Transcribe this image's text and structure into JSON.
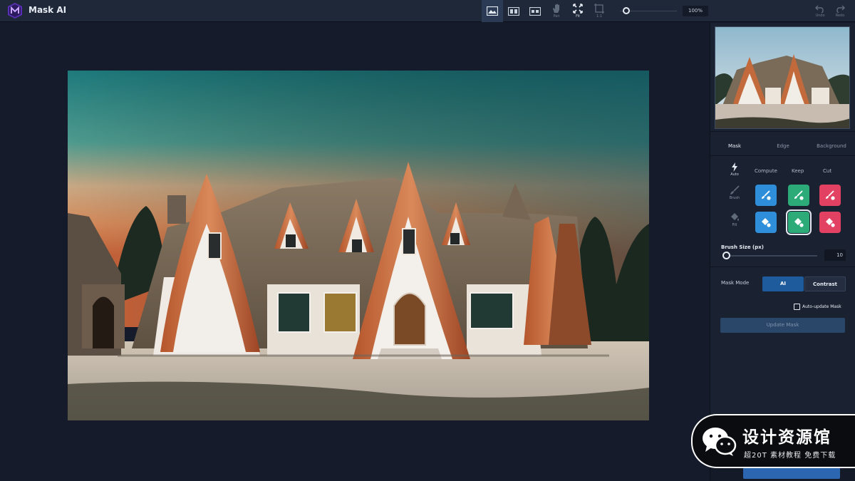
{
  "app": {
    "title": "Mask AI",
    "logo_icon": "mask-ai-logo-icon",
    "accent_color": "#7b3fe4"
  },
  "toolbar": {
    "tools": [
      {
        "name": "single-view-icon",
        "label": "",
        "active": true
      },
      {
        "name": "split-view-icon",
        "label": "",
        "active": false
      },
      {
        "name": "side-by-side-view-icon",
        "label": "",
        "active": false
      },
      {
        "name": "pan-hand-icon",
        "label": "Pan",
        "active": false
      },
      {
        "name": "fit-icon",
        "label": "Fit",
        "active": false
      },
      {
        "name": "crop-icon",
        "label": "1:1",
        "active": false
      }
    ],
    "zoom_value": "100%",
    "undo_label": "Undo",
    "redo_label": "Redo"
  },
  "panel": {
    "tabs": [
      {
        "label": "Mask",
        "active": true
      },
      {
        "label": "Edge",
        "active": false
      },
      {
        "label": "Background",
        "active": false
      }
    ],
    "tool_rows": [
      {
        "icon": "auto-lightning-icon",
        "label": "Auto"
      },
      {
        "icon": "brush-icon",
        "label": "Brush"
      },
      {
        "icon": "fill-bucket-icon",
        "label": "Fill"
      }
    ],
    "columns": [
      "Compute",
      "Keep",
      "Cut"
    ],
    "brush_size_label": "Brush Size (px)",
    "brush_size_value": "10",
    "brush_size_fraction": 0.0,
    "mask_mode_label": "Mask Mode",
    "mask_mode_options": [
      {
        "label": "AI",
        "active": true
      },
      {
        "label": "Contrast",
        "active": false
      }
    ],
    "auto_update_label": "Auto-update Mask",
    "auto_update_checked": false,
    "update_button_label": "Update Mask"
  },
  "colors": {
    "compute": "#2f8ed9",
    "keep": "#2cab79",
    "cut": "#e24162"
  },
  "watermark": {
    "title": "设计资源馆",
    "subtitle": "超20T 素材教程 免费下载"
  }
}
